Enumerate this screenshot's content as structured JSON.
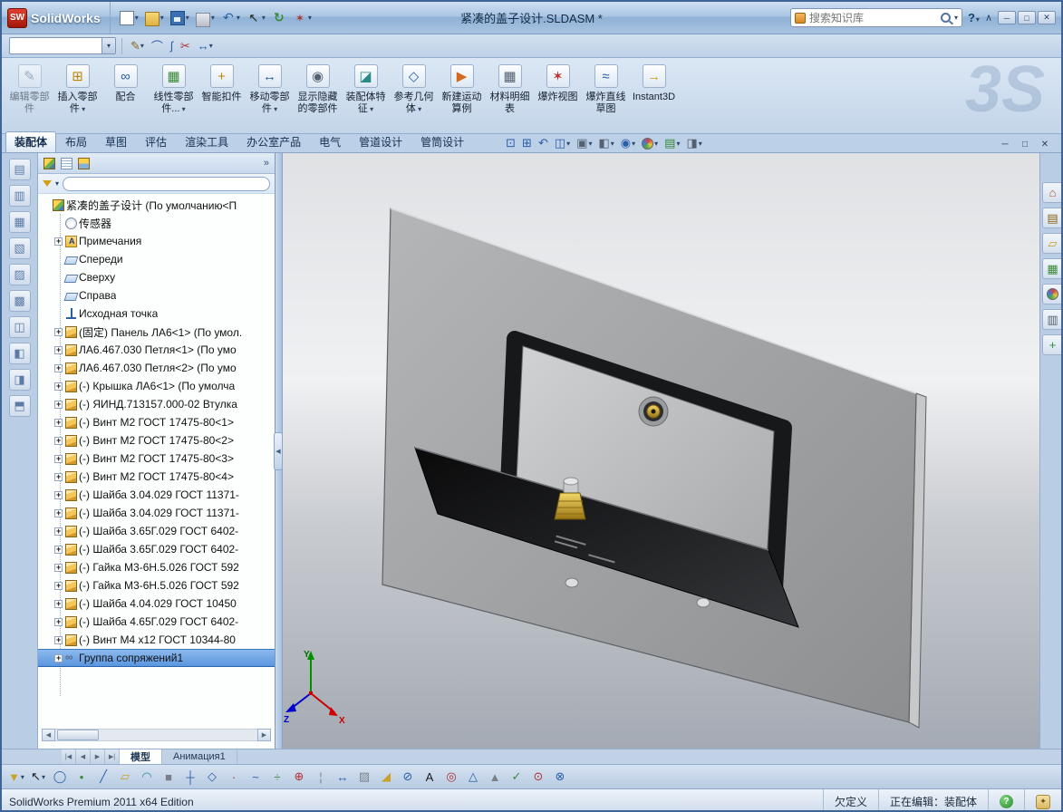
{
  "titlebar": {
    "logo_text": "SW",
    "app_name": "SolidWorks",
    "doc_title": "紧凑的盖子设计.SLDASM *",
    "search_placeholder": "搜索知识库",
    "help_label": "?",
    "collapse_glyph": "∧",
    "quick_tools": [
      {
        "name": "new-document",
        "shape": "new",
        "dd": true
      },
      {
        "name": "open",
        "shape": "open",
        "dd": true
      },
      {
        "name": "save",
        "shape": "save",
        "dd": true
      },
      {
        "name": "print",
        "shape": "print",
        "dd": true
      },
      {
        "name": "undo",
        "shape": "undo",
        "dd": true
      },
      {
        "name": "select",
        "shape": "select",
        "dd": true
      },
      {
        "name": "rebuild",
        "shape": "rebuild"
      },
      {
        "name": "options",
        "shape": "options",
        "dd": true
      }
    ],
    "window_buttons": [
      {
        "name": "minimize-button",
        "g": "─"
      },
      {
        "name": "maximize-button",
        "g": "□"
      },
      {
        "name": "close-button",
        "g": "✕"
      }
    ]
  },
  "row2": {
    "combo_value": "",
    "tools": [
      {
        "name": "sketch",
        "g": "✎",
        "c": "#8a6414",
        "dd": true
      },
      {
        "name": "arc",
        "g": "⌒",
        "c": "#2a5fa8"
      },
      {
        "name": "spline",
        "g": "ʃ",
        "c": "#2a5fa8"
      },
      {
        "name": "trim",
        "g": "✂",
        "c": "#b03030"
      },
      {
        "name": "dimension",
        "g": "↔",
        "c": "#2a5fa8",
        "dd": true
      }
    ]
  },
  "ribbon": {
    "watermark": "3S",
    "buttons": [
      {
        "name": "edit-component",
        "label": "编辑零部件",
        "g": "✎",
        "c": "#6a7a90",
        "disabled": true
      },
      {
        "name": "insert-component",
        "label": "插入零部件",
        "g": "⊞",
        "c": "#b8860b",
        "dd": true
      },
      {
        "name": "mate",
        "label": "配合",
        "g": "∞",
        "c": "#2a5fa8"
      },
      {
        "name": "linear-component-pattern",
        "label": "线性零部件...",
        "g": "▦",
        "c": "#3a8a3a",
        "dd": true
      },
      {
        "name": "smart-fasteners",
        "label": "智能扣件",
        "g": "+",
        "c": "#b8860b"
      },
      {
        "name": "move-component",
        "label": "移动零部件",
        "g": "↔",
        "c": "#2a5fa8",
        "dd": true
      },
      {
        "name": "show-hidden-components",
        "label": "显示隐藏的零部件",
        "g": "◉",
        "c": "#556070"
      },
      {
        "name": "assembly-features",
        "label": "装配体特征",
        "g": "◪",
        "c": "#2a8a8a",
        "dd": true
      },
      {
        "name": "reference-geometry",
        "label": "参考几何体",
        "g": "◇",
        "c": "#2a5fa8",
        "dd": true
      },
      {
        "name": "new-motion-study",
        "label": "新建运动算例",
        "g": "▶",
        "c": "#d2691e"
      },
      {
        "name": "bill-of-materials",
        "label": "材料明细表",
        "g": "▦",
        "c": "#556070"
      },
      {
        "name": "exploded-view",
        "label": "爆炸视图",
        "g": "✶",
        "c": "#c03030"
      },
      {
        "name": "explode-line-sketch",
        "label": "爆炸直线草图",
        "g": "≈",
        "c": "#2a5fa8"
      },
      {
        "name": "instant3d",
        "label": "Instant3D",
        "g": "→",
        "c": "#d4a017"
      }
    ]
  },
  "cmtabs": {
    "tabs": [
      {
        "label": "装配体",
        "active": true
      },
      {
        "label": "布局"
      },
      {
        "label": "草图"
      },
      {
        "label": "评估"
      },
      {
        "label": "渲染工具"
      },
      {
        "label": "办公室产品"
      },
      {
        "label": "电气"
      },
      {
        "label": "管道设计"
      },
      {
        "label": "管筒设计"
      }
    ],
    "view_tools": [
      {
        "name": "zoom-to-fit",
        "g": "⊡",
        "c": "#2a5fa8"
      },
      {
        "name": "zoom-to-area",
        "g": "⊞",
        "c": "#2a5fa8"
      },
      {
        "name": "previous-view",
        "g": "↶",
        "c": "#2a5fa8"
      },
      {
        "name": "section-view",
        "g": "◫",
        "c": "#2a5fa8",
        "dd": true
      },
      {
        "name": "view-orientation",
        "g": "▣",
        "c": "#556070",
        "dd": true
      },
      {
        "name": "display-style",
        "g": "◧",
        "c": "#556070",
        "dd": true
      },
      {
        "name": "hide-show-items",
        "g": "◉",
        "c": "#2a5fa8",
        "dd": true
      },
      {
        "name": "edit-appearance",
        "ball": true,
        "dd": true
      },
      {
        "name": "apply-scene",
        "g": "▤",
        "c": "#3a8a3a",
        "dd": true
      },
      {
        "name": "view-settings",
        "g": "◨",
        "c": "#556070",
        "dd": true
      }
    ],
    "doc_buttons": [
      {
        "name": "doc-minimize-button",
        "g": "─"
      },
      {
        "name": "doc-restore-button",
        "g": "□"
      },
      {
        "name": "doc-close-button",
        "g": "✕"
      }
    ]
  },
  "left_toolbar": [
    {
      "name": "left-dock-tool-1",
      "g": "▤"
    },
    {
      "name": "left-dock-tool-2",
      "g": "▥"
    },
    {
      "name": "left-dock-tool-3",
      "g": "▦"
    },
    {
      "name": "left-dock-tool-4",
      "g": "▧"
    },
    {
      "name": "left-dock-tool-5",
      "g": "▨"
    },
    {
      "name": "left-dock-tool-6",
      "g": "▩"
    },
    {
      "name": "left-dock-tool-7",
      "g": "◫"
    },
    {
      "name": "left-dock-tool-8",
      "g": "◧"
    },
    {
      "name": "left-dock-tool-9",
      "g": "◨"
    },
    {
      "name": "left-dock-tool-10",
      "g": "⬒"
    }
  ],
  "tree": {
    "header_more": "»",
    "header_tabs": [
      {
        "name": "featuremanager-tab",
        "icon": "assembly"
      },
      {
        "name": "propertymanager-tab",
        "icon": "props"
      },
      {
        "name": "configurationmanager-tab",
        "icon": "config"
      },
      {
        "name": "displaymanager-tab",
        "ball": true
      }
    ],
    "filter_value": "",
    "items": [
      {
        "label": "紧凑的盖子设计 (По умолчанию<П",
        "icon": "assembly",
        "indent": 0
      },
      {
        "label": "传感器",
        "icon": "sensors",
        "indent": 1
      },
      {
        "label": "Примечания",
        "icon": "annotations",
        "exp": true,
        "indent": 1
      },
      {
        "label": "Спереди",
        "icon": "plane",
        "indent": 1
      },
      {
        "label": "Сверху",
        "icon": "plane",
        "indent": 1
      },
      {
        "label": "Справа",
        "icon": "plane",
        "indent": 1
      },
      {
        "label": "Исходная точка",
        "icon": "origin",
        "indent": 1
      },
      {
        "label": "(固定) Панель ЛА6<1> (По умол.",
        "icon": "part",
        "exp": true,
        "indent": 1
      },
      {
        "label": "ЛА6.467.030 Петля<1> (По умо",
        "icon": "part",
        "exp": true,
        "indent": 1
      },
      {
        "label": "ЛА6.467.030 Петля<2> (По умо",
        "icon": "part",
        "exp": true,
        "indent": 1
      },
      {
        "label": "(-) Крышка ЛА6<1> (По умолча",
        "icon": "part",
        "exp": true,
        "indent": 1
      },
      {
        "label": "(-) ЯИНД.713157.000-02 Втулка",
        "icon": "part",
        "exp": true,
        "indent": 1
      },
      {
        "label": "(-) Винт М2 ГОСТ 17475-80<1>",
        "icon": "part",
        "exp": true,
        "indent": 1
      },
      {
        "label": "(-) Винт М2 ГОСТ 17475-80<2>",
        "icon": "part",
        "exp": true,
        "indent": 1
      },
      {
        "label": "(-) Винт М2 ГОСТ 17475-80<3>",
        "icon": "part",
        "exp": true,
        "indent": 1
      },
      {
        "label": "(-) Винт М2 ГОСТ 17475-80<4>",
        "icon": "part",
        "exp": true,
        "indent": 1
      },
      {
        "label": "(-) Шайба 3.04.029 ГОСТ 11371-",
        "icon": "part",
        "exp": true,
        "indent": 1
      },
      {
        "label": "(-) Шайба 3.04.029 ГОСТ 11371-",
        "icon": "part",
        "exp": true,
        "indent": 1
      },
      {
        "label": "(-) Шайба 3.65Г.029 ГОСТ 6402-",
        "icon": "part",
        "exp": true,
        "indent": 1
      },
      {
        "label": "(-) Шайба 3.65Г.029 ГОСТ 6402-",
        "icon": "part",
        "exp": true,
        "indent": 1
      },
      {
        "label": "(-) Гайка М3-6Н.5.026 ГОСТ 592",
        "icon": "part",
        "exp": true,
        "indent": 1
      },
      {
        "label": "(-) Гайка М3-6Н.5.026 ГОСТ 592",
        "icon": "part",
        "exp": true,
        "indent": 1
      },
      {
        "label": "(-) Шайба 4.04.029  ГОСТ 10450",
        "icon": "part",
        "exp": true,
        "indent": 1
      },
      {
        "label": "(-) Шайба 4.65Г.029 ГОСТ 6402-",
        "icon": "part",
        "exp": true,
        "indent": 1
      },
      {
        "label": "(-) Винт М4 х12 ГОСТ 10344-80",
        "icon": "part",
        "exp": true,
        "indent": 1
      },
      {
        "label": "Группа сопряжений1",
        "icon": "mategroup",
        "exp": true,
        "indent": 1,
        "sel": true
      }
    ]
  },
  "task_pane": [
    {
      "name": "solidworks-resources",
      "g": "⌂",
      "c": "#b05030"
    },
    {
      "name": "design-library",
      "g": "▤",
      "c": "#8a6414"
    },
    {
      "name": "file-explorer",
      "g": "▱",
      "c": "#c9a227"
    },
    {
      "name": "view-palette",
      "g": "▦",
      "c": "#3a8a3a"
    },
    {
      "name": "appearances-scenes",
      "ball": true
    },
    {
      "name": "custom-properties",
      "g": "▥",
      "c": "#556070"
    },
    {
      "name": "document-recovery",
      "g": "+",
      "c": "#2a8a3a"
    }
  ],
  "bottom_tabs": {
    "nav": [
      {
        "name": "first-tab-button",
        "g": "|◀"
      },
      {
        "name": "prev-tab-button",
        "g": "◀"
      },
      {
        "name": "next-tab-button",
        "g": "▶"
      },
      {
        "name": "last-tab-button",
        "g": "▶|"
      }
    ],
    "tabs": [
      {
        "label": "模型",
        "active": true
      },
      {
        "label": "Анимация1"
      }
    ]
  },
  "bottom_toolbar": [
    {
      "name": "selection-filter-toggle",
      "g": "▼",
      "c": "#c9a227",
      "dd": true
    },
    {
      "name": "select-tool",
      "g": "↖",
      "c": "#1a1a1a",
      "dd": true
    },
    {
      "name": "magnified-selection",
      "g": "◯",
      "c": "#2a5fa8"
    },
    {
      "name": "filter-vertices",
      "g": "•",
      "c": "#3a8a3a"
    },
    {
      "name": "filter-edges",
      "g": "╱",
      "c": "#2a5fa8"
    },
    {
      "name": "filter-faces",
      "g": "▱",
      "c": "#c9a227"
    },
    {
      "name": "filter-surface-bodies",
      "g": "◠",
      "c": "#2a8aa8"
    },
    {
      "name": "filter-solid-bodies",
      "g": "■",
      "c": "#7a7f88"
    },
    {
      "name": "filter-axes",
      "g": "┼",
      "c": "#2a5fa8"
    },
    {
      "name": "filter-planes",
      "g": "◇",
      "c": "#2a5fa8"
    },
    {
      "name": "filter-sketch-points",
      "g": "∙",
      "c": "#b03030"
    },
    {
      "name": "filter-sketch-segments",
      "g": "~",
      "c": "#2a5fa8"
    },
    {
      "name": "filter-midpoints",
      "g": "÷",
      "c": "#3a8a3a"
    },
    {
      "name": "filter-center-marks",
      "g": "⊕",
      "c": "#b03030"
    },
    {
      "name": "filter-centerlines",
      "g": "¦",
      "c": "#7a7f88"
    },
    {
      "name": "filter-dimensions",
      "g": "↔",
      "c": "#2a5fa8"
    },
    {
      "name": "filter-hatches",
      "g": "▨",
      "c": "#7a7f88"
    },
    {
      "name": "filter-weld-beads",
      "g": "◢",
      "c": "#c9a227"
    },
    {
      "name": "filter-gtol",
      "g": "⊘",
      "c": "#2a5fa8"
    },
    {
      "name": "filter-notes",
      "g": "A",
      "c": "#1a1a1a"
    },
    {
      "name": "filter-balloons",
      "g": "◎",
      "c": "#b03030"
    },
    {
      "name": "filter-datums",
      "g": "△",
      "c": "#2a5fa8"
    },
    {
      "name": "filter-weld-symbols",
      "g": "▲",
      "c": "#7a7f88"
    },
    {
      "name": "filter-surface-finish",
      "g": "✓",
      "c": "#3a8a3a"
    },
    {
      "name": "filter-connection-points",
      "g": "⊙",
      "c": "#b03030"
    },
    {
      "name": "filter-routing-points",
      "g": "⊗",
      "c": "#2a5fa8"
    }
  ],
  "statusbar": {
    "left": "SolidWorks Premium 2011 x64 Edition",
    "definition_status": "欠定义",
    "editing_status": "正在编辑：装配体",
    "help_glyph": "?",
    "tip_glyph": "✦"
  },
  "viewport": {
    "triad": {
      "x": "X",
      "y": "Y",
      "z": "Z"
    }
  }
}
